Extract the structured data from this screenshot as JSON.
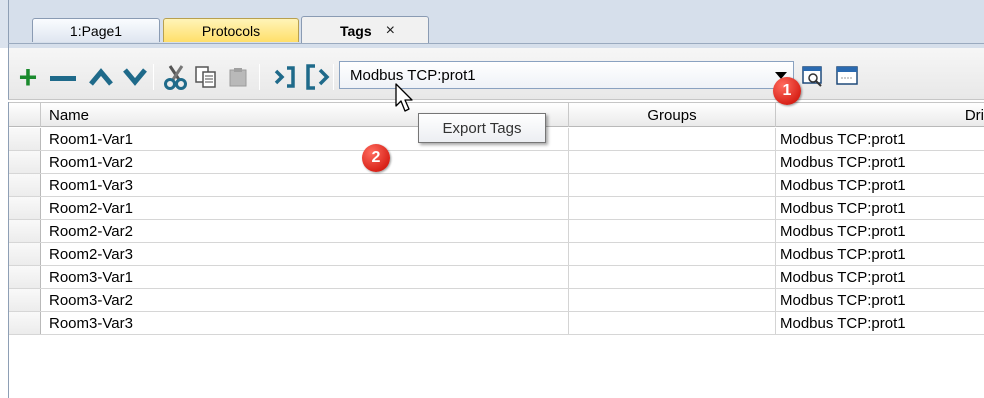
{
  "tabs": [
    {
      "label": "1:Page1",
      "active": false
    },
    {
      "label": "Protocols",
      "active": false
    },
    {
      "label": "Tags",
      "active": true,
      "close_symbol": "×"
    }
  ],
  "toolbar": {
    "icons": [
      "add-icon",
      "remove-icon",
      "move-up-icon",
      "move-down-icon",
      "cut-icon",
      "copy-icon",
      "paste-icon",
      "import-tags-icon",
      "export-tags-icon",
      "browse-icon",
      "window-icon"
    ],
    "protocol_selected": "Modbus TCP:prot1"
  },
  "tooltip": {
    "text": "Export Tags"
  },
  "badges": [
    "1",
    "2"
  ],
  "table": {
    "columns": [
      "Name",
      "Groups",
      "Dri"
    ],
    "rows": [
      {
        "name": "Room1-Var1",
        "groups": "",
        "driver": "Modbus TCP:prot1"
      },
      {
        "name": "Room1-Var2",
        "groups": "",
        "driver": "Modbus TCP:prot1"
      },
      {
        "name": "Room1-Var3",
        "groups": "",
        "driver": "Modbus TCP:prot1"
      },
      {
        "name": "Room2-Var1",
        "groups": "",
        "driver": "Modbus TCP:prot1"
      },
      {
        "name": "Room2-Var2",
        "groups": "",
        "driver": "Modbus TCP:prot1"
      },
      {
        "name": "Room2-Var3",
        "groups": "",
        "driver": "Modbus TCP:prot1"
      },
      {
        "name": "Room3-Var1",
        "groups": "",
        "driver": "Modbus TCP:prot1"
      },
      {
        "name": "Room3-Var2",
        "groups": "",
        "driver": "Modbus TCP:prot1"
      },
      {
        "name": "Room3-Var3",
        "groups": "",
        "driver": "Modbus TCP:prot1"
      }
    ]
  },
  "colors": {
    "protocols_tab": "#ffdf6a",
    "add_green": "#1a8a2d",
    "teal_glyph": "#1f6a8a",
    "badge_red": "#d9241a"
  }
}
